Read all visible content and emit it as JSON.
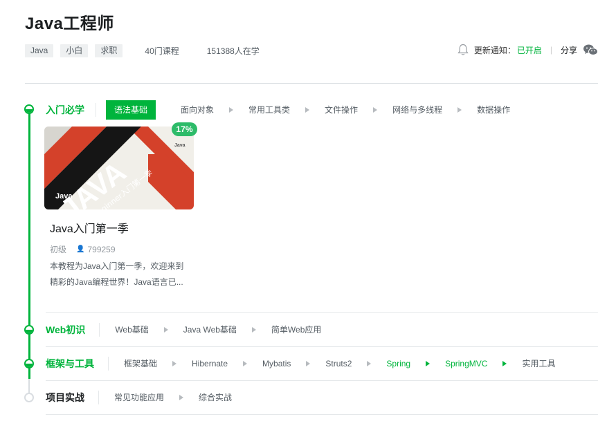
{
  "header": {
    "title": "Java工程师",
    "tags": [
      "Java",
      "小白",
      "求职"
    ],
    "course_count": "40门课程",
    "learners": "151388人在学",
    "notify_label": "更新通知：",
    "notify_status": "已开启",
    "separator": "|",
    "share_label": "分享"
  },
  "stages": [
    {
      "name": "入门必学",
      "items": [
        "语法基础",
        "面向对象",
        "常用工具类",
        "文件操作",
        "网络与多线程",
        "数据操作"
      ],
      "active_index": 0
    },
    {
      "name": "Web初识",
      "items": [
        "Web基础",
        "Java Web基础",
        "简单Web应用"
      ]
    },
    {
      "name": "框架与工具",
      "items": [
        "框架基础",
        "Hibernate",
        "Mybatis",
        "Struts2",
        "Spring",
        "SpringMVC",
        "实用工具"
      ],
      "green_indices": [
        4,
        5
      ]
    },
    {
      "name": "项目实战",
      "items": [
        "常见功能应用",
        "综合实战"
      ]
    }
  ],
  "course_card": {
    "progress": "17%",
    "image_label": "Java",
    "image_text_big": "JAVA",
    "image_text_sub": "Beginner入门第一季",
    "image_logo": "Java",
    "title": "Java入门第一季",
    "level": "初级",
    "learners": "799259",
    "description": "本教程为Java入门第一季，欢迎来到精彩的Java编程世界！Java语言已..."
  },
  "colors": {
    "accent": "#00b43c",
    "badge": "#2dbb69"
  },
  "icons": [
    "bell-icon",
    "wechat-icon",
    "person-icon",
    "arrow-right-icon"
  ]
}
